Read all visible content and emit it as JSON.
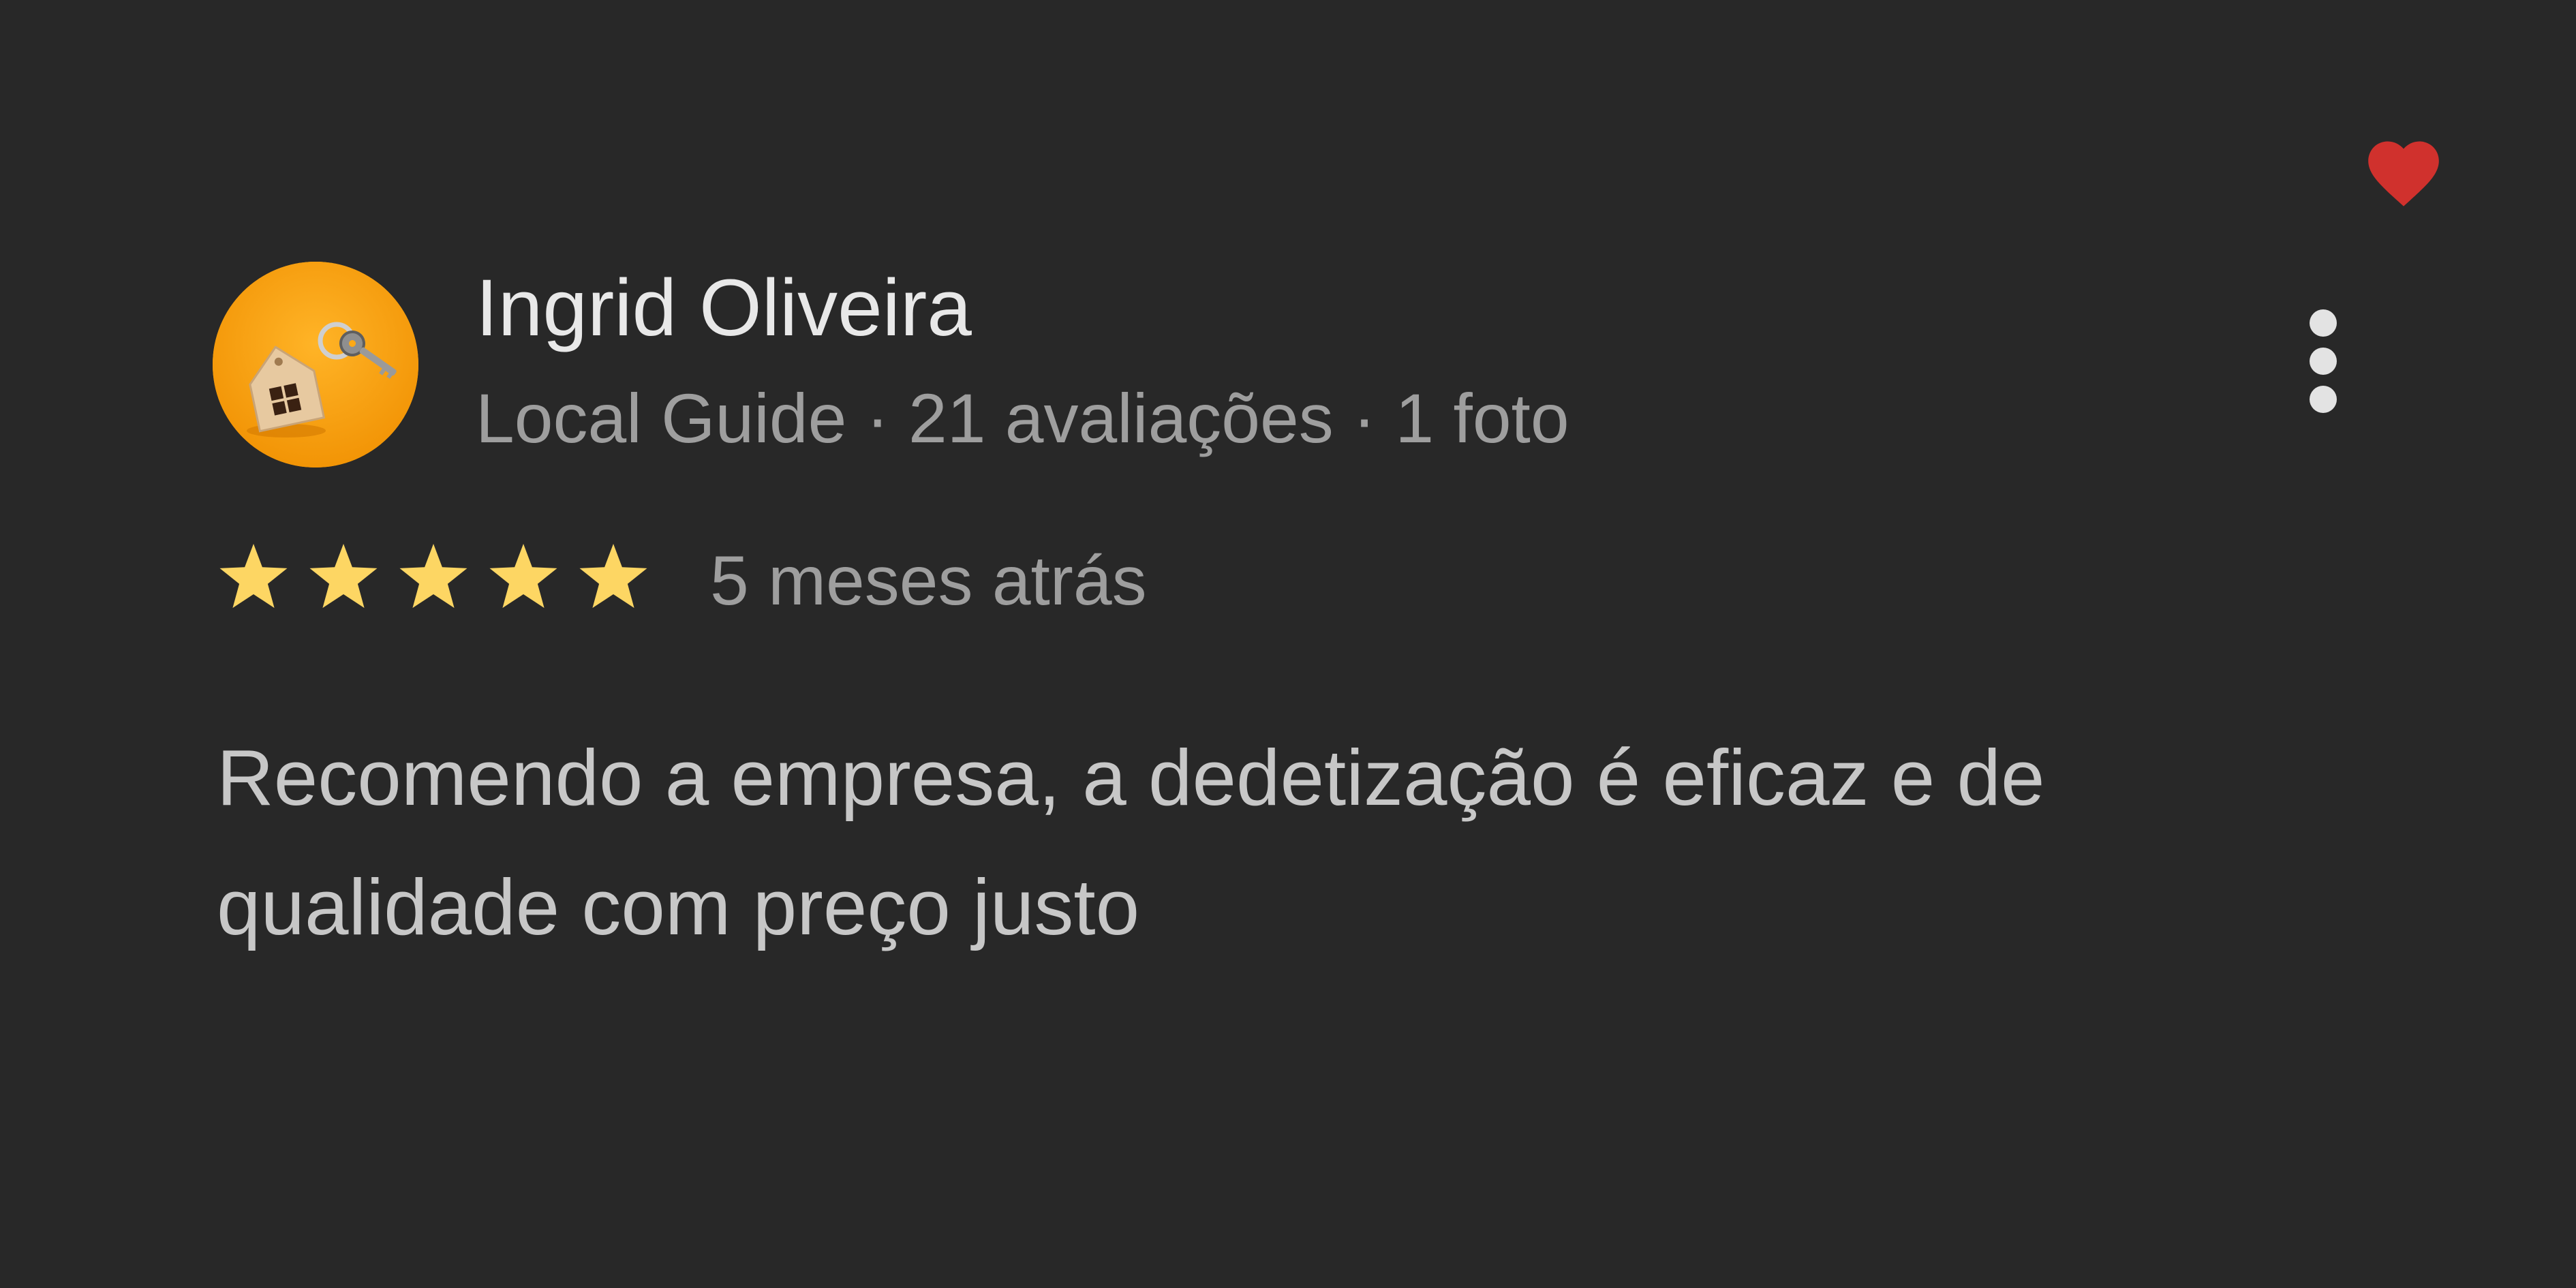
{
  "review": {
    "author": {
      "name": "Ingrid Oliveira",
      "meta": "Local Guide · 21 avaliações · 1 foto",
      "avatar_icon": "house-key-icon"
    },
    "rating": {
      "stars": 5,
      "max": 5,
      "star_color": "#fdd663"
    },
    "time_ago": "5 meses atrás",
    "text": "Recomendo a empresa, a dedetização é eficaz e de qualidade com preço justo",
    "liked": true,
    "icons": {
      "like": "heart-icon",
      "menu": "more-vertical-icon",
      "star": "star-icon"
    },
    "colors": {
      "background": "#282828",
      "heart": "#d0312d",
      "avatar_background": "#f6a20a",
      "name": "#e8e8e8",
      "secondary_text": "#9e9e9e",
      "body_text": "#c7c7c7"
    }
  }
}
